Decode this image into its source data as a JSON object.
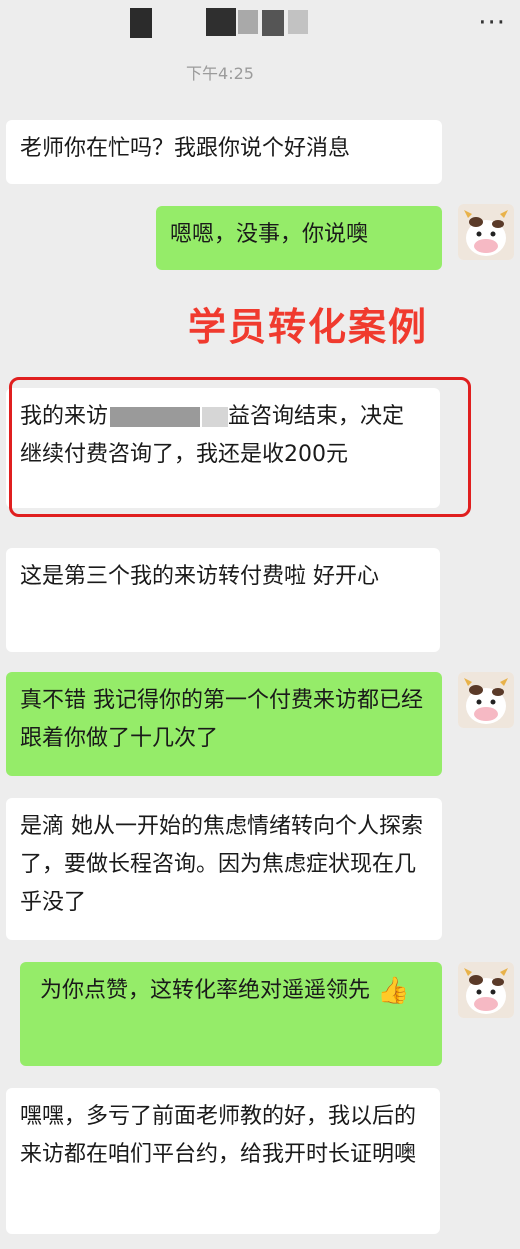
{
  "header": {
    "more_icon": "more-dots-icon",
    "more_label": "···"
  },
  "timestamp": "下午4:25",
  "annotation": "学员转化案例",
  "messages": [
    {
      "side": "left",
      "text": "老师你在忙吗？我跟你说个好消息"
    },
    {
      "side": "right",
      "text": "嗯嗯，没事，你说噢"
    },
    {
      "side": "left",
      "text_before": "我的来访",
      "text_after": "益咨询结束，决定继续付费咨询了，我还是收200元"
    },
    {
      "side": "left",
      "text": "这是第三个我的来访转付费啦 好开心"
    },
    {
      "side": "right",
      "text": "真不错   我记得你的第一个付费来访都已经跟着你做了十几次了"
    },
    {
      "side": "left",
      "text": "是滴  她从一开始的焦虑情绪转向个人探索了，要做长程咨询。因为焦虑症状现在几乎没了"
    },
    {
      "side": "right",
      "text": "为你点赞，这转化率绝对遥遥领先",
      "emoji": "👍"
    },
    {
      "side": "left",
      "text": "嘿嘿，多亏了前面老师教的好，我以后的来访都在咱们平台约，给我开时长证明噢"
    }
  ],
  "colors": {
    "background": "#ededed",
    "sent_bubble": "#95ec69",
    "received_bubble": "#ffffff",
    "annotation": "#f03a2e"
  }
}
